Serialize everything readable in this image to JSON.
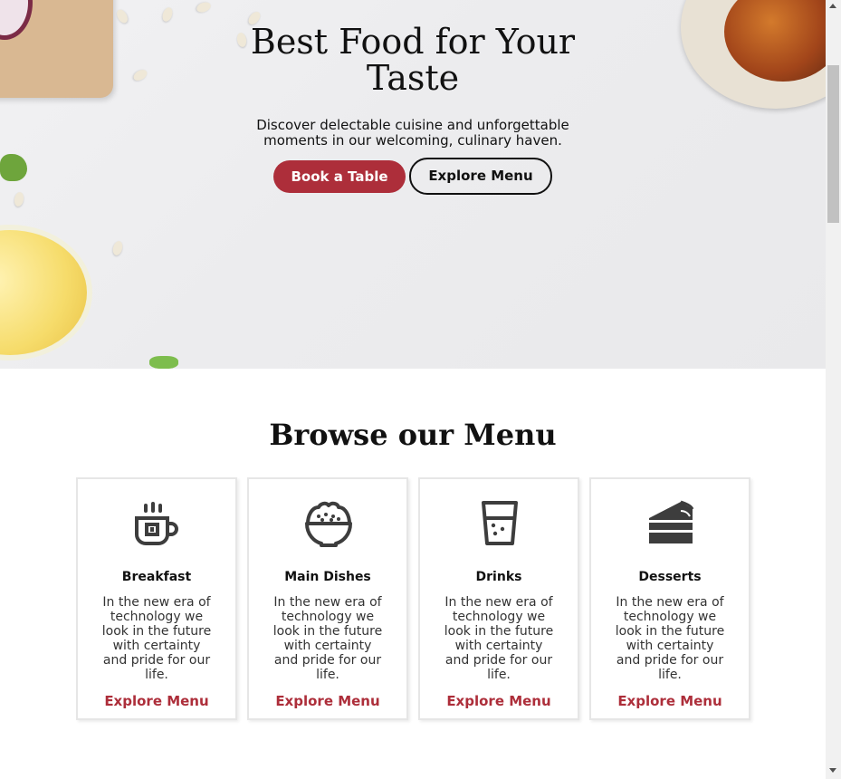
{
  "hero": {
    "title_line1": "Best Food for Your",
    "title_line2": "Taste",
    "subtitle_line1": "Discover delectable cuisine and unforgettable",
    "subtitle_line2": "moments in our welcoming, culinary haven.",
    "book_button": "Book a Table",
    "explore_button": "Explore Menu"
  },
  "menu": {
    "title": "Browse our Menu",
    "cards": [
      {
        "icon": "coffee-cup-icon",
        "title": "Breakfast",
        "desc_lines": [
          "In the new era of",
          "technology we",
          "look in the future",
          "with certainty",
          "and pride for our",
          "life."
        ],
        "link": "Explore Menu"
      },
      {
        "icon": "rice-bowl-icon",
        "title": "Main Dishes",
        "desc_lines": [
          "In the new era of",
          "technology we",
          "look in the future",
          "with certainty",
          "and pride for our",
          "life."
        ],
        "link": "Explore Menu"
      },
      {
        "icon": "drink-glass-icon",
        "title": "Drinks",
        "desc_lines": [
          "In the new era of",
          "technology we",
          "look in the future",
          "with certainty",
          "and pride for our",
          "life."
        ],
        "link": "Explore Menu"
      },
      {
        "icon": "cake-slice-icon",
        "title": "Desserts",
        "desc_lines": [
          "In the new era of",
          "technology we",
          "look in the future",
          "with certainty",
          "and pride for our",
          "life."
        ],
        "link": "Explore Menu"
      }
    ]
  },
  "colors": {
    "accent": "#ad2e3a",
    "text": "#111111",
    "icon": "#3d3d3d"
  }
}
